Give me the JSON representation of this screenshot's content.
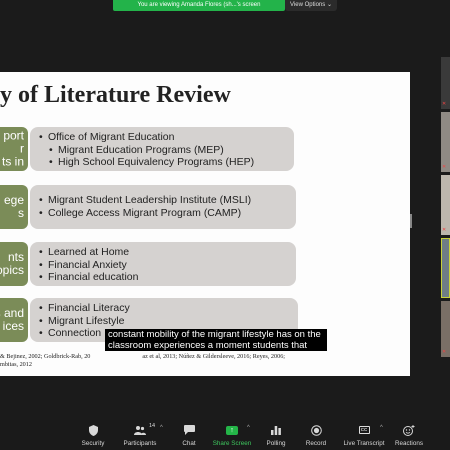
{
  "banner": {
    "viewing_text": "You are viewing Amanda Flores (sh...'s screen",
    "view_options_label": "View Options ⌄"
  },
  "slide": {
    "title": "y of Literature Review",
    "rows": [
      {
        "left_label": "port\nr\nts in",
        "items": [
          {
            "text": "Office of Migrant Education",
            "level": 0
          },
          {
            "text": "Migrant Education Programs (MEP)",
            "level": 1
          },
          {
            "text": "High School Equivalency Programs (HEP)",
            "level": 1
          }
        ]
      },
      {
        "left_label": "ege\ns",
        "items": [
          {
            "text": "Migrant Student Leadership Institute (MSLI)",
            "level": 0
          },
          {
            "text": "College Access Migrant Program (CAMP)",
            "level": 0
          }
        ]
      },
      {
        "left_label": "nts\nopics",
        "items": [
          {
            "text": "Learned at Home",
            "level": 0
          },
          {
            "text": "Financial Anxiety",
            "level": 0
          },
          {
            "text": "Financial education",
            "level": 0
          }
        ]
      },
      {
        "left_label": "s and\nices",
        "items": [
          {
            "text": "Financial Literacy",
            "level": 0
          },
          {
            "text": "Migrant Lifestyle",
            "level": 0
          },
          {
            "text": "Connection",
            "level": 0
          }
        ]
      }
    ],
    "caption": "constant mobility of the migrant lifestyle has on the classroom experiences a moment students that",
    "citation_line1": "& Bejinez, 2002; Goldbrick-Rab, 20",
    "citation_line1_tail": "az et al, 2013; Núñez & Gildersleeve, 2016; Reyes, 2006;",
    "citation_line2": "mbitas, 2012"
  },
  "toolbar": {
    "security_label": "Security",
    "participants_label": "Participants",
    "participants_count": "14",
    "chat_label": "Chat",
    "share_label": "Share Screen",
    "polling_label": "Polling",
    "record_label": "Record",
    "cc_icon_text": "CC",
    "live_transcript_label": "Live Transcript",
    "reactions_label": "Reactions",
    "caret": "^"
  },
  "colors": {
    "banner_green": "#23b34a",
    "left_box_olive": "#7b8c58",
    "right_box_gray": "#d5d2d0",
    "share_green": "#24b548"
  }
}
